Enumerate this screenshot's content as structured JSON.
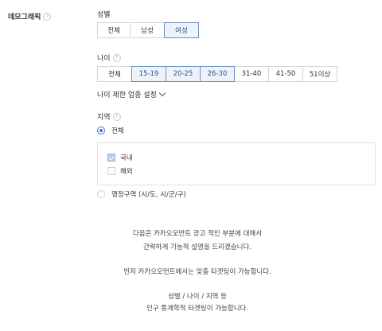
{
  "demographic": {
    "title": "데모그래픽"
  },
  "gender": {
    "label": "성별",
    "options": [
      "전체",
      "남성",
      "여성"
    ],
    "selected": [
      "여성"
    ]
  },
  "age": {
    "label": "나이",
    "options": [
      "전체",
      "15-19",
      "20-25",
      "26-30",
      "31-40",
      "41-50",
      "51이상"
    ],
    "selected": [
      "15-19",
      "20-25",
      "26-30"
    ]
  },
  "age_restriction_link": "나이 제한 업종 설정",
  "region": {
    "label": "지역",
    "radio_all": "전체",
    "radio_admin": "행정구역 (시/도, 시/군/구)",
    "selected_radio": "전체",
    "checks": [
      {
        "label": "국내",
        "checked": true
      },
      {
        "label": "해외",
        "checked": false
      }
    ]
  },
  "description": {
    "line1": "다음은 카카오모먼트 광고 적인 부분에 대해서",
    "line2": "간략하게 기능적 설명을 드리겠습니다.",
    "line3": "먼저 카카오모먼트에서는 맞춤 타겟팅이 가능합니다.",
    "line4": "성별 / 나이 / 지역 등",
    "line5": "인구 통계학적 타겟팅이 가능합니다."
  },
  "colors": {
    "accent": "#3a6fc7",
    "selected_bg": "#eef3fb",
    "selected_border": "#6b8fc2"
  }
}
